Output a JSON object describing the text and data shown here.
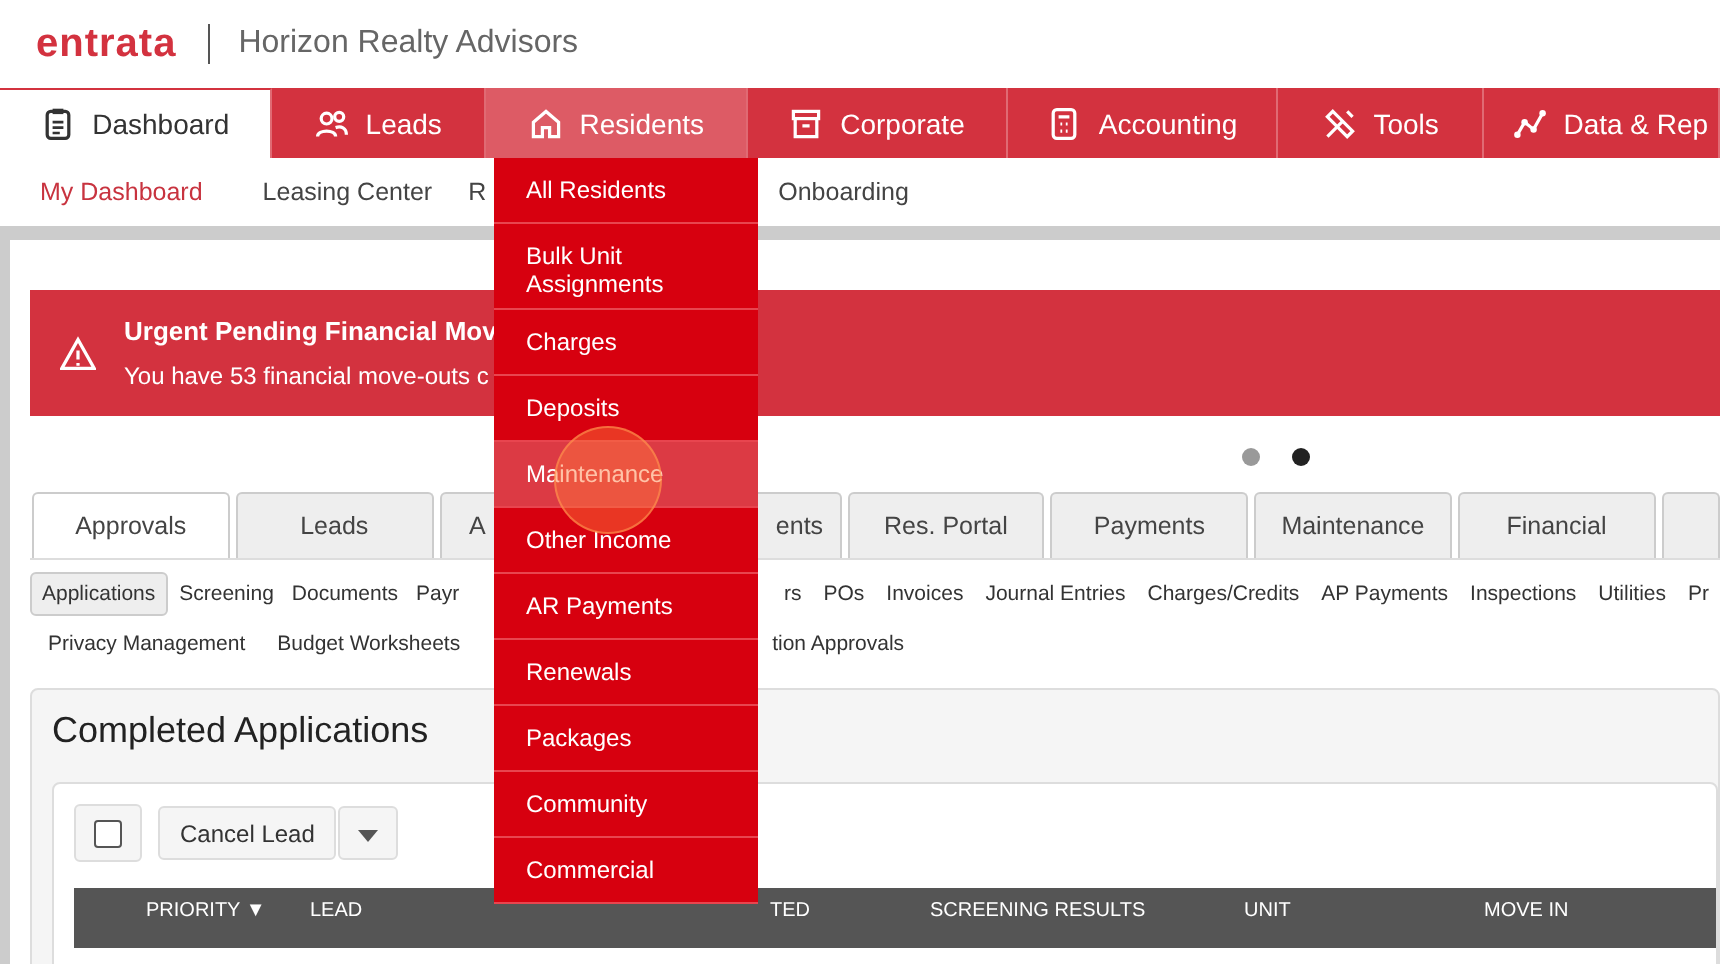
{
  "header": {
    "logo": "entrata",
    "company": "Horizon Realty Advisors"
  },
  "nav": [
    {
      "label": "Dashboard",
      "selected": true,
      "highlighted": false
    },
    {
      "label": "Leads",
      "selected": false,
      "highlighted": false
    },
    {
      "label": "Residents",
      "selected": false,
      "highlighted": true
    },
    {
      "label": "Corporate",
      "selected": false,
      "highlighted": false
    },
    {
      "label": "Accounting",
      "selected": false,
      "highlighted": false
    },
    {
      "label": "Tools",
      "selected": false,
      "highlighted": false
    },
    {
      "label": "Data & Rep",
      "selected": false,
      "highlighted": false
    }
  ],
  "subnav": [
    {
      "label": "My Dashboard",
      "selected": true
    },
    {
      "label": "Leasing Center",
      "selected": false
    },
    {
      "label": "R",
      "selected": false
    },
    {
      "label": "Onboarding",
      "selected": false
    }
  ],
  "residents_menu": [
    {
      "label": "All Residents",
      "highlighted": false
    },
    {
      "label": "Bulk Unit Assignments",
      "highlighted": false
    },
    {
      "label": "Charges",
      "highlighted": false
    },
    {
      "label": "Deposits",
      "highlighted": false
    },
    {
      "label": "Maintenance",
      "highlighted": true
    },
    {
      "label": "Other Income",
      "highlighted": false
    },
    {
      "label": "AR Payments",
      "highlighted": false
    },
    {
      "label": "Renewals",
      "highlighted": false
    },
    {
      "label": "Packages",
      "highlighted": false
    },
    {
      "label": "Community",
      "highlighted": false
    },
    {
      "label": "Commercial",
      "highlighted": false
    }
  ],
  "alert": {
    "title": "Urgent Pending Financial Mov",
    "message": "You have 53 financial move-outs c"
  },
  "carousel_dots": [
    {
      "selected": false
    },
    {
      "selected": true
    }
  ],
  "tabs": [
    {
      "label": "Approvals",
      "selected": true
    },
    {
      "label": "Leads",
      "selected": false
    },
    {
      "label": "A",
      "selected": false
    },
    {
      "label": "ents",
      "selected": false
    },
    {
      "label": "Res. Portal",
      "selected": false
    },
    {
      "label": "Payments",
      "selected": false
    },
    {
      "label": "Maintenance",
      "selected": false
    },
    {
      "label": "Financial",
      "selected": false
    }
  ],
  "subtabs_row_1": [
    {
      "label": "Applications",
      "selected": true
    },
    {
      "label": "Screening",
      "selected": false
    },
    {
      "label": "Documents",
      "selected": false
    },
    {
      "label": "Payr",
      "selected": false
    },
    {
      "label": "rs",
      "selected": false
    },
    {
      "label": "POs",
      "selected": false
    },
    {
      "label": "Invoices",
      "selected": false
    },
    {
      "label": "Journal Entries",
      "selected": false
    },
    {
      "label": "Charges/Credits",
      "selected": false
    },
    {
      "label": "AP Payments",
      "selected": false
    },
    {
      "label": "Inspections",
      "selected": false
    },
    {
      "label": "Utilities",
      "selected": false
    },
    {
      "label": "Pr",
      "selected": false
    }
  ],
  "subtabs_row_2": [
    {
      "label": "Privacy Management",
      "selected": false
    },
    {
      "label": "Budget Worksheets",
      "selected": false
    },
    {
      "label": "tion Approvals",
      "selected": false
    }
  ],
  "panel": {
    "title": "Completed Applications",
    "select_all_checked": false,
    "action_button": "Cancel Lead",
    "columns": [
      "PRIORITY ▼",
      "LEAD",
      "TED",
      "SCREENING RESULTS",
      "UNIT",
      "MOVE IN"
    ]
  }
}
